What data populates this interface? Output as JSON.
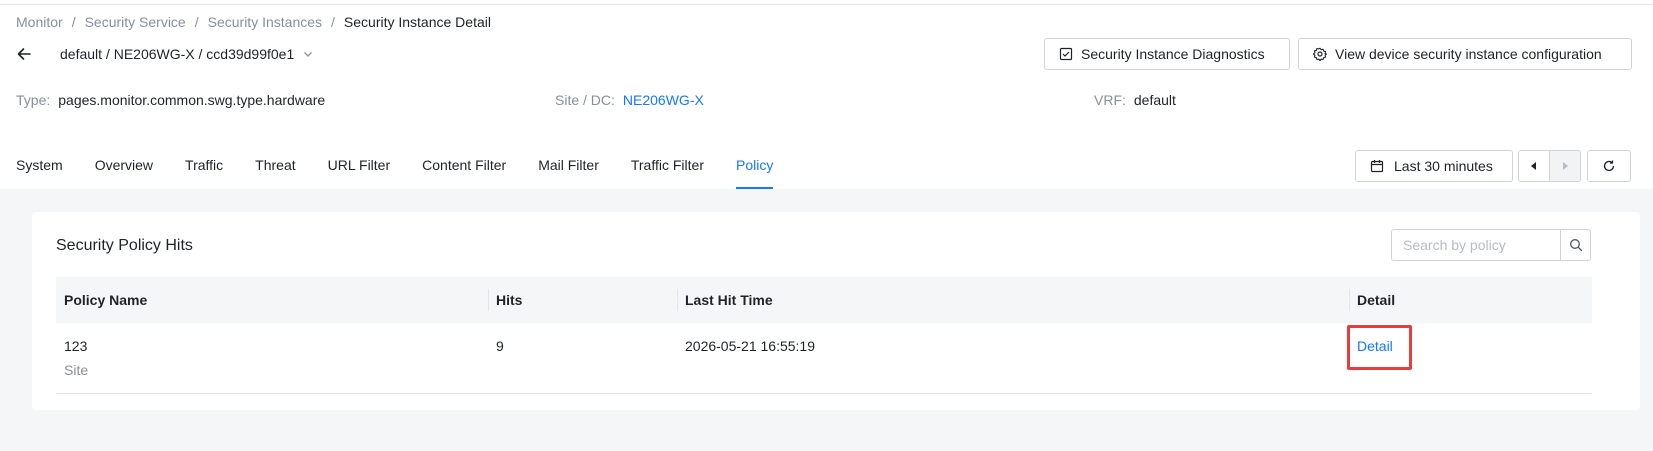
{
  "breadcrumb": [
    {
      "label": "Monitor"
    },
    {
      "label": "Security Service"
    },
    {
      "label": "Security Instances"
    },
    {
      "label": "Security Instance Detail"
    }
  ],
  "breadcrumb_sep": "/",
  "instance_selector": {
    "value": "default / NE206WG-X / ccd39d99f0e1"
  },
  "header_buttons": {
    "diagnostics": "Security Instance Diagnostics",
    "view_config": "View device security instance configuration"
  },
  "meta": {
    "type_label": "Type",
    "type_value": "pages.monitor.common.swg.type.hardware",
    "site_label": "Site / DC",
    "site_value": "NE206WG-X",
    "vrf_label": "VRF",
    "vrf_value": "default",
    "colon": ":"
  },
  "tabs": [
    {
      "label": "System"
    },
    {
      "label": "Overview"
    },
    {
      "label": "Traffic"
    },
    {
      "label": "Threat"
    },
    {
      "label": "URL Filter"
    },
    {
      "label": "Content Filter"
    },
    {
      "label": "Mail Filter"
    },
    {
      "label": "Traffic Filter"
    },
    {
      "label": "Policy",
      "active": true
    }
  ],
  "time_range": {
    "label": "Last 30 minutes"
  },
  "card": {
    "title": "Security Policy Hits",
    "search_placeholder": "Search by policy"
  },
  "table": {
    "columns": [
      "Policy Name",
      "Hits",
      "Last Hit Time",
      "Detail"
    ],
    "rows": [
      {
        "policy_name": "123",
        "policy_scope": "Site",
        "hits": "9",
        "last_hit_time": "2026-05-21 16:55:19",
        "detail": "Detail"
      }
    ]
  },
  "colors": {
    "accent": "#1677ff",
    "highlight": "#e83d3d",
    "muted_text": "#86909c",
    "content_bg": "#f5f6f7"
  },
  "icons": {
    "back": "arrow-left-icon",
    "dropdown": "chevron-down-icon",
    "diagnostics": "checkbox-icon",
    "config": "gear-icon",
    "calendar": "calendar-icon",
    "prev": "caret-left-icon",
    "next": "caret-right-icon",
    "refresh": "refresh-icon",
    "search": "search-icon"
  }
}
